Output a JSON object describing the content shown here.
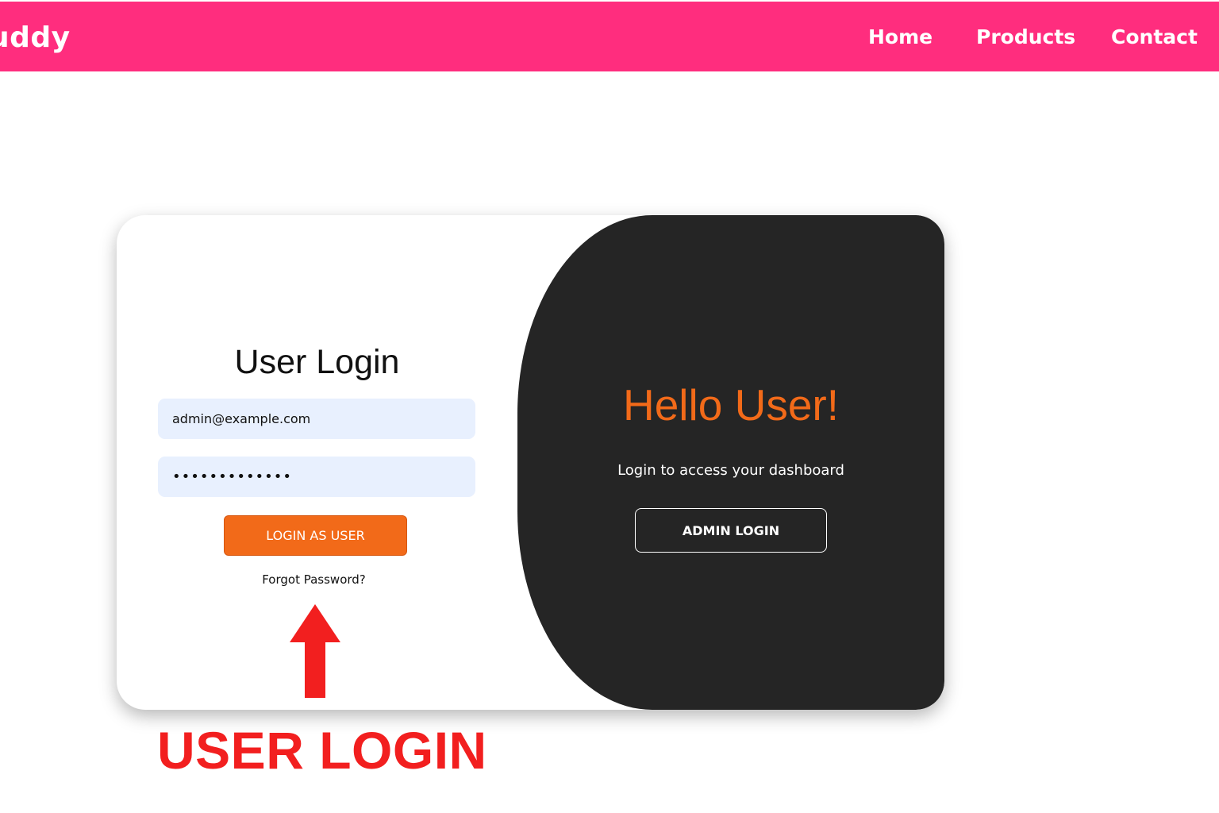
{
  "navbar": {
    "brand": "uddy",
    "links": [
      {
        "label": "Home"
      },
      {
        "label": "Products"
      },
      {
        "label": "Contact"
      }
    ],
    "color": "#ff2d7e"
  },
  "login_form": {
    "title": "User Login",
    "email_value": "admin@example.com",
    "password_value": "•••••••••••••",
    "submit_label": "LOGIN AS USER",
    "forgot_label": "Forgot Password?",
    "accent_color": "#f26a19"
  },
  "side_panel": {
    "greeting": "Hello User!",
    "subtitle": "Login to access your dashboard",
    "admin_button_label": "ADMIN LOGIN",
    "background_color": "#252525"
  },
  "annotation": {
    "text": "USER LOGIN",
    "arrow_icon": "up-arrow-icon",
    "color": "#f21f1f"
  }
}
